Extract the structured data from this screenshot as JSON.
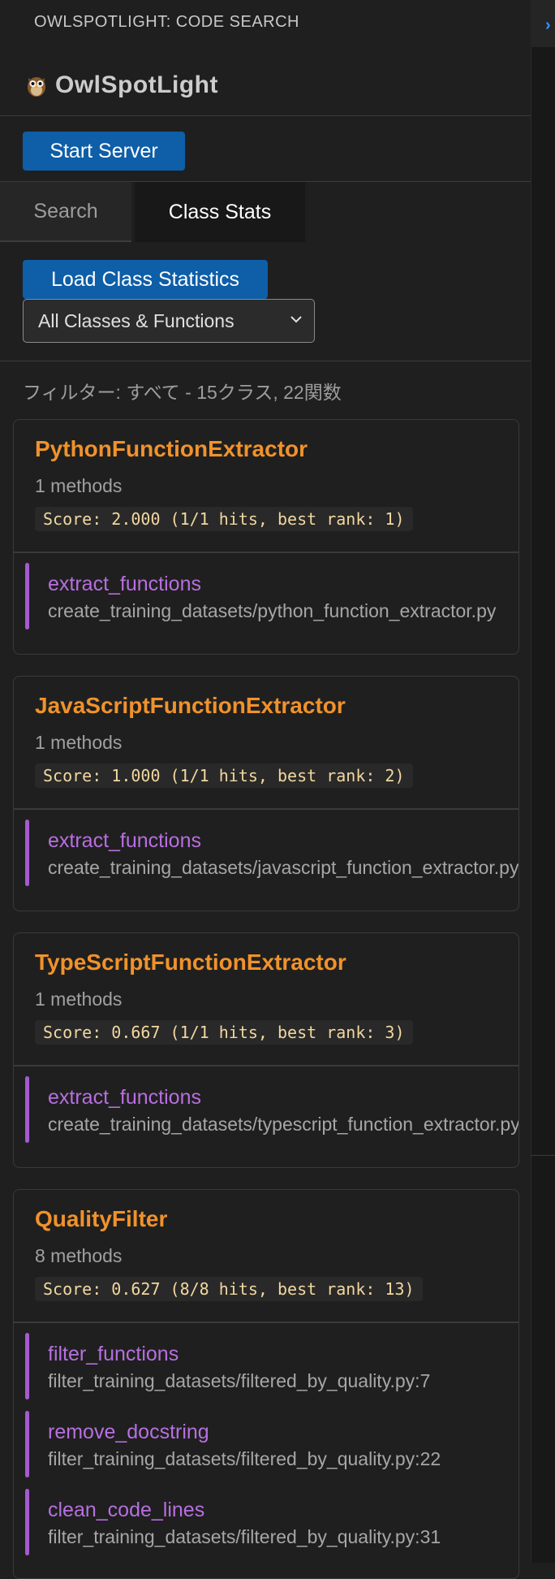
{
  "header": {
    "view_title": "OWLSPOTLIGHT: CODE SEARCH",
    "brand": "OwlSpotLight"
  },
  "toolbar": {
    "start_server": "Start Server",
    "load_stats": "Load Class Statistics"
  },
  "tabs": [
    {
      "label": "Search",
      "active": false
    },
    {
      "label": "Class Stats",
      "active": true
    }
  ],
  "filter": {
    "selected": "All Classes & Functions",
    "summary": "フィルター: すべて - 15クラス, 22関数"
  },
  "classes": [
    {
      "name": "PythonFunctionExtractor",
      "methods_count": "1 methods",
      "score": "Score: 2.000 (1/1 hits, best rank: 1)",
      "methods": [
        {
          "name": "extract_functions",
          "path": "create_training_datasets/python_function_extractor.py"
        }
      ]
    },
    {
      "name": "JavaScriptFunctionExtractor",
      "methods_count": "1 methods",
      "score": "Score: 1.000 (1/1 hits, best rank: 2)",
      "methods": [
        {
          "name": "extract_functions",
          "path": "create_training_datasets/javascript_function_extractor.py"
        }
      ]
    },
    {
      "name": "TypeScriptFunctionExtractor",
      "methods_count": "1 methods",
      "score": "Score: 0.667 (1/1 hits, best rank: 3)",
      "methods": [
        {
          "name": "extract_functions",
          "path": "create_training_datasets/typescript_function_extractor.py"
        }
      ]
    },
    {
      "name": "QualityFilter",
      "methods_count": "8 methods",
      "score": "Score: 0.627 (8/8 hits, best rank: 13)",
      "methods": [
        {
          "name": "filter_functions",
          "path": "filter_training_datasets/filtered_by_quality.py:7"
        },
        {
          "name": "remove_docstring",
          "path": "filter_training_datasets/filtered_by_quality.py:22"
        },
        {
          "name": "clean_code_lines",
          "path": "filter_training_datasets/filtered_by_quality.py:31"
        }
      ]
    }
  ],
  "colors": {
    "button": "#0e5ea8",
    "class_name": "#f0922b",
    "method_name": "#b76fe0",
    "score_text": "#f2d7a0"
  },
  "icons": {
    "brand": "owl-icon",
    "select": "chevron-down-icon",
    "collapse": "chevron-right-icon"
  }
}
